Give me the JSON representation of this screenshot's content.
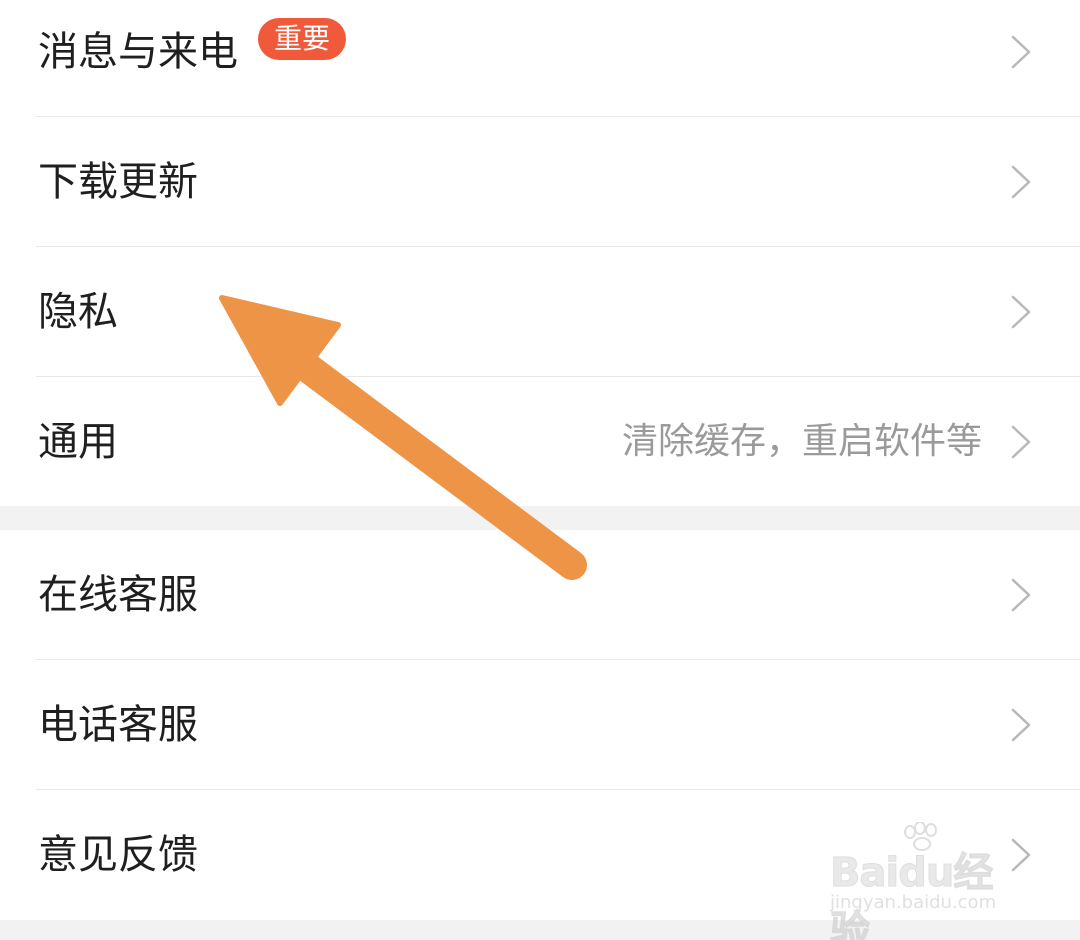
{
  "section_1": {
    "items": [
      {
        "label": "消息与来电",
        "badge": "重要"
      },
      {
        "label": "下载更新"
      },
      {
        "label": "隐私"
      },
      {
        "label": "通用",
        "hint": "清除缓存，重启软件等"
      }
    ]
  },
  "section_2": {
    "items": [
      {
        "label": "在线客服"
      },
      {
        "label": "电话客服"
      },
      {
        "label": "意见反馈"
      }
    ]
  },
  "icons": {
    "row_chevron": "chevron-right-icon",
    "annotation": "arrow-up-left-icon"
  },
  "colors": {
    "badge": "#f05a3a",
    "arrow": "#ee9447",
    "label": "#1f1f1f",
    "hint": "#9a9a9a",
    "chevron": "#b8b8b8",
    "background": "#f2f2f2"
  },
  "watermark": {
    "brand_latin": "Baidu",
    "brand_cn": "经验",
    "site": "jingyan.baidu.com"
  }
}
